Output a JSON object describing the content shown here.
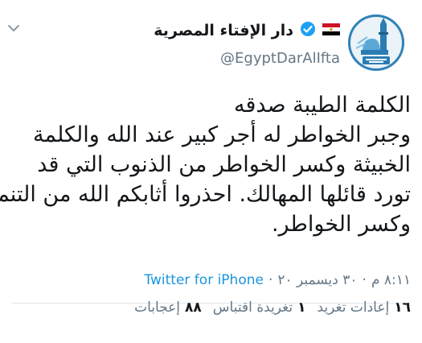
{
  "account": {
    "display_name": "دار الإفتاء المصرية",
    "handle": "@EgyptDarAlIfta",
    "avatar_caption": "دار الإفتاء المصرية"
  },
  "icons": {
    "menu": "chevron-down-icon",
    "flag": "egypt-flag-icon",
    "verified": "verified-badge-icon"
  },
  "tweet": {
    "lines": [
      "الكلمة الطيبة صدقه",
      "وجبر الخواطر له أجر كبير عند الله والكلمة",
      "الخبيثة وكسر الخواطر  من الذنوب التي قد",
      "تورد قائلها المهالك. احذروا أثابكم الله من التنمر",
      "وكسر الخواطر."
    ]
  },
  "meta": {
    "time": "٨:١١ م",
    "sep1": "·",
    "date": "٣٠ ديسمبر ٢٠",
    "sep2": "·",
    "source": "Twitter for iPhone"
  },
  "stats": {
    "retweets_count": "١٦",
    "retweets_label": "إعادات تغريد",
    "quotes_count": "١",
    "quotes_label": "تغريدة اقتباس",
    "likes_count": "٨٨",
    "likes_label": "إعجابات"
  },
  "colors": {
    "text": "#14171a",
    "muted": "#657786",
    "link": "#1b95e0",
    "verified": "#1da1f2",
    "divider": "#e1e8ed"
  }
}
